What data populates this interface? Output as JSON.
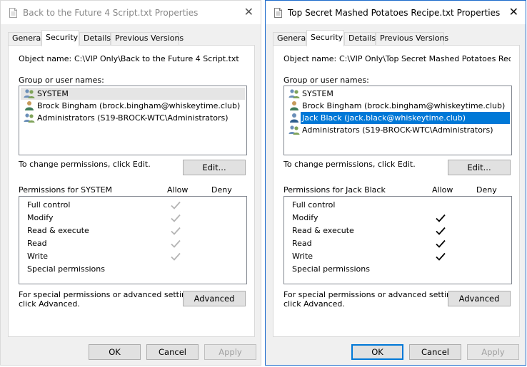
{
  "tabs": [
    "General",
    "Security",
    "Details",
    "Previous Versions"
  ],
  "labels": {
    "object_name": "Object name:",
    "group_names": "Group or user names:",
    "change_perms": "To change permissions, click Edit.",
    "edit": "Edit...",
    "allow": "Allow",
    "deny": "Deny",
    "special_line1": "For special permissions or advanced settings,",
    "special_line2": "click Advanced.",
    "advanced": "Advanced",
    "ok": "OK",
    "cancel": "Cancel",
    "apply": "Apply"
  },
  "permissions": [
    "Full control",
    "Modify",
    "Read & execute",
    "Read",
    "Write",
    "Special permissions"
  ],
  "left": {
    "title": "Back to the Future 4 Script.txt Properties",
    "object_path": "C:\\VIP Only\\Back to the Future 4 Script.txt",
    "users": [
      "SYSTEM",
      "Brock Bingham (brock.bingham@whiskeytime.club)",
      "Administrators (S19-BROCK-WTC\\Administrators)"
    ],
    "permissions_for": "Permissions for SYSTEM",
    "allow": [
      true,
      true,
      true,
      true,
      true,
      false
    ],
    "allow_style": "grayed"
  },
  "right": {
    "title": "Top Secret Mashed Potatoes Recipe.txt Properties",
    "object_path": "C:\\VIP Only\\Top Secret Mashed Potatoes Recipe.",
    "users": [
      "SYSTEM",
      "Brock Bingham (brock.bingham@whiskeytime.club)",
      "Jack Black (jack.black@whiskeytime.club)",
      "Administrators (S19-BROCK-WTC\\Administrators)"
    ],
    "selected_user": "Jack Black (jack.black@whiskeytime.club)",
    "permissions_for": "Permissions for Jack Black",
    "allow": [
      false,
      true,
      true,
      true,
      true,
      false
    ],
    "allow_style": "active"
  },
  "colors": {
    "selection": "#0078d7",
    "focus_border": "#0078d7",
    "panel_bg": "#f0f0f0"
  },
  "icons": [
    "text-file-icon",
    "close-icon",
    "group-user-icon",
    "single-user-icon",
    "checkmark-icon"
  ]
}
